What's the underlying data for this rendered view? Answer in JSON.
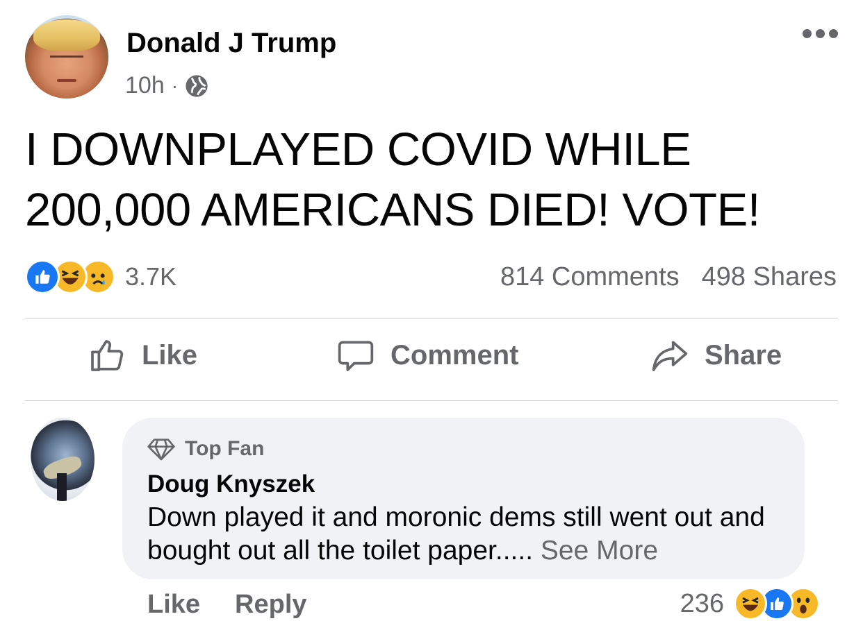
{
  "post": {
    "author": "Donald J Trump",
    "time": "10h",
    "separator": "·",
    "privacy_icon": "globe-icon",
    "text": "I DOWNPLAYED COVID WHILE\n200,000 AMERICANS DIED!  VOTE!",
    "reaction_icons": [
      "like-icon",
      "haha-icon",
      "sad-icon"
    ],
    "reaction_count": "3.7K",
    "comments_count": "814 Comments",
    "shares_count": "498 Shares"
  },
  "actions": {
    "like_label": "Like",
    "comment_label": "Comment",
    "share_label": "Share"
  },
  "comment": {
    "badge": "Top Fan",
    "author": "Doug Knyszek",
    "text": "Down played it and moronic dems still went out and bought out all the toilet paper.....",
    "see_more": "See More",
    "like_label": "Like",
    "reply_label": "Reply",
    "reaction_count": "236",
    "reaction_icons": [
      "haha-icon",
      "like-icon",
      "wow-icon"
    ]
  },
  "colors": {
    "like_blue": "#1877f2",
    "emoji_yellow": "#f7b928",
    "secondary_text": "#65676b",
    "bubble_bg": "#f0f2f5"
  }
}
